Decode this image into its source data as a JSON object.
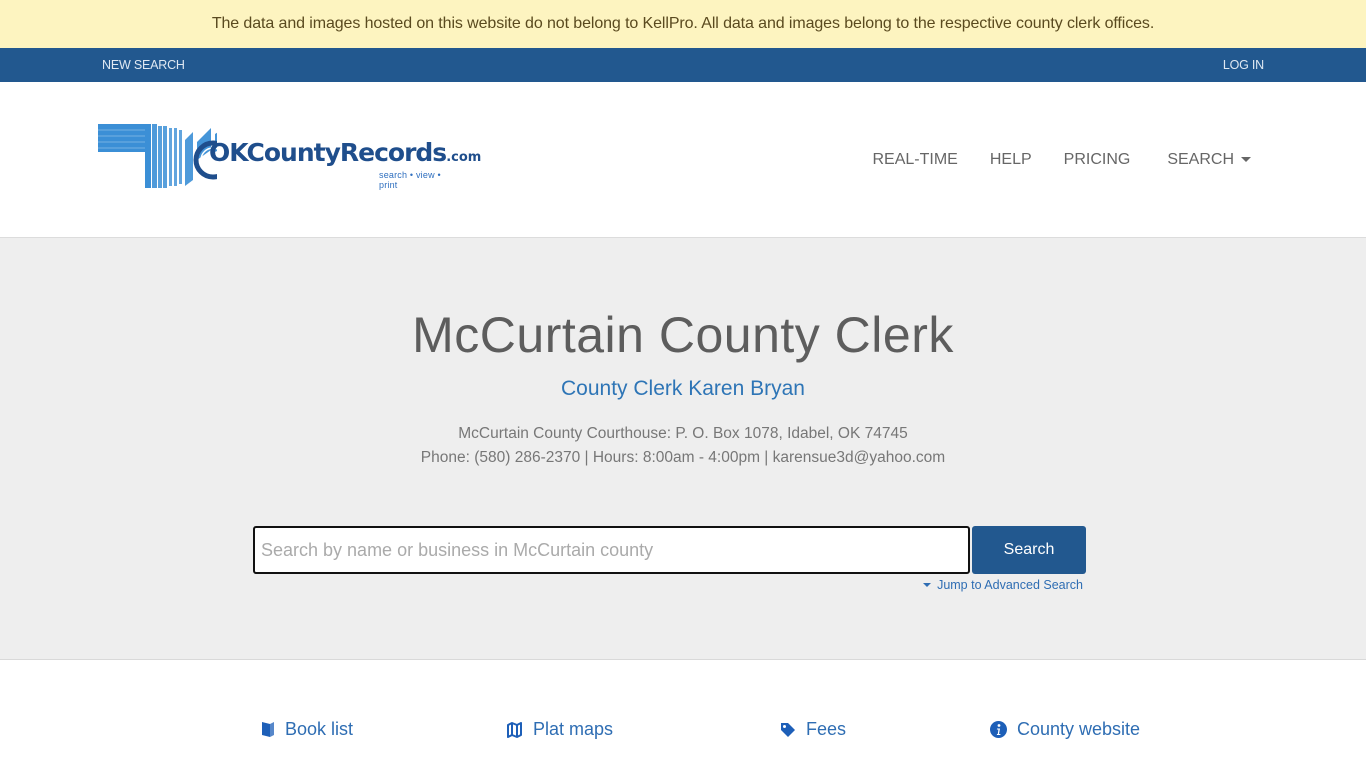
{
  "notice": {
    "text": "The data and images hosted on this website do not belong to KellPro. All data and images belong to the respective county clerk offices."
  },
  "top_nav": {
    "new_search": "NEW SEARCH",
    "login": "LOG IN"
  },
  "logo": {
    "brand": "OKCountyRecords",
    "suffix": ".com",
    "tagline": "search • view • print",
    "trademark": "™"
  },
  "main_nav": {
    "items": [
      {
        "label": "REAL-TIME"
      },
      {
        "label": "HELP"
      },
      {
        "label": "PRICING"
      },
      {
        "label": "SEARCH",
        "icon": "caret-down-icon"
      }
    ]
  },
  "hero": {
    "title": "McCurtain County Clerk",
    "subtitle": "County Clerk Karen Bryan",
    "address_line": "McCurtain County Courthouse: P. O. Box 1078, Idabel, OK 74745",
    "contact_line": "Phone: (580) 286-2370 | Hours: 8:00am - 4:00pm | karensue3d@yahoo.com"
  },
  "search": {
    "value": "",
    "placeholder": "Search by name or business in McCurtain county",
    "button_label": "Search",
    "advanced_link": "Jump to Advanced Search"
  },
  "quick_links": [
    {
      "label": "Book list",
      "icon": "book-icon"
    },
    {
      "label": "Plat maps",
      "icon": "map-icon"
    },
    {
      "label": "Fees",
      "icon": "tag-icon"
    },
    {
      "label": "County website",
      "icon": "info-circle-icon"
    }
  ],
  "colors": {
    "notice_bg": "#fdf4c0",
    "nav_bg": "#22588f",
    "accent": "#2e6db3",
    "hero_bg": "#eeeeee"
  }
}
